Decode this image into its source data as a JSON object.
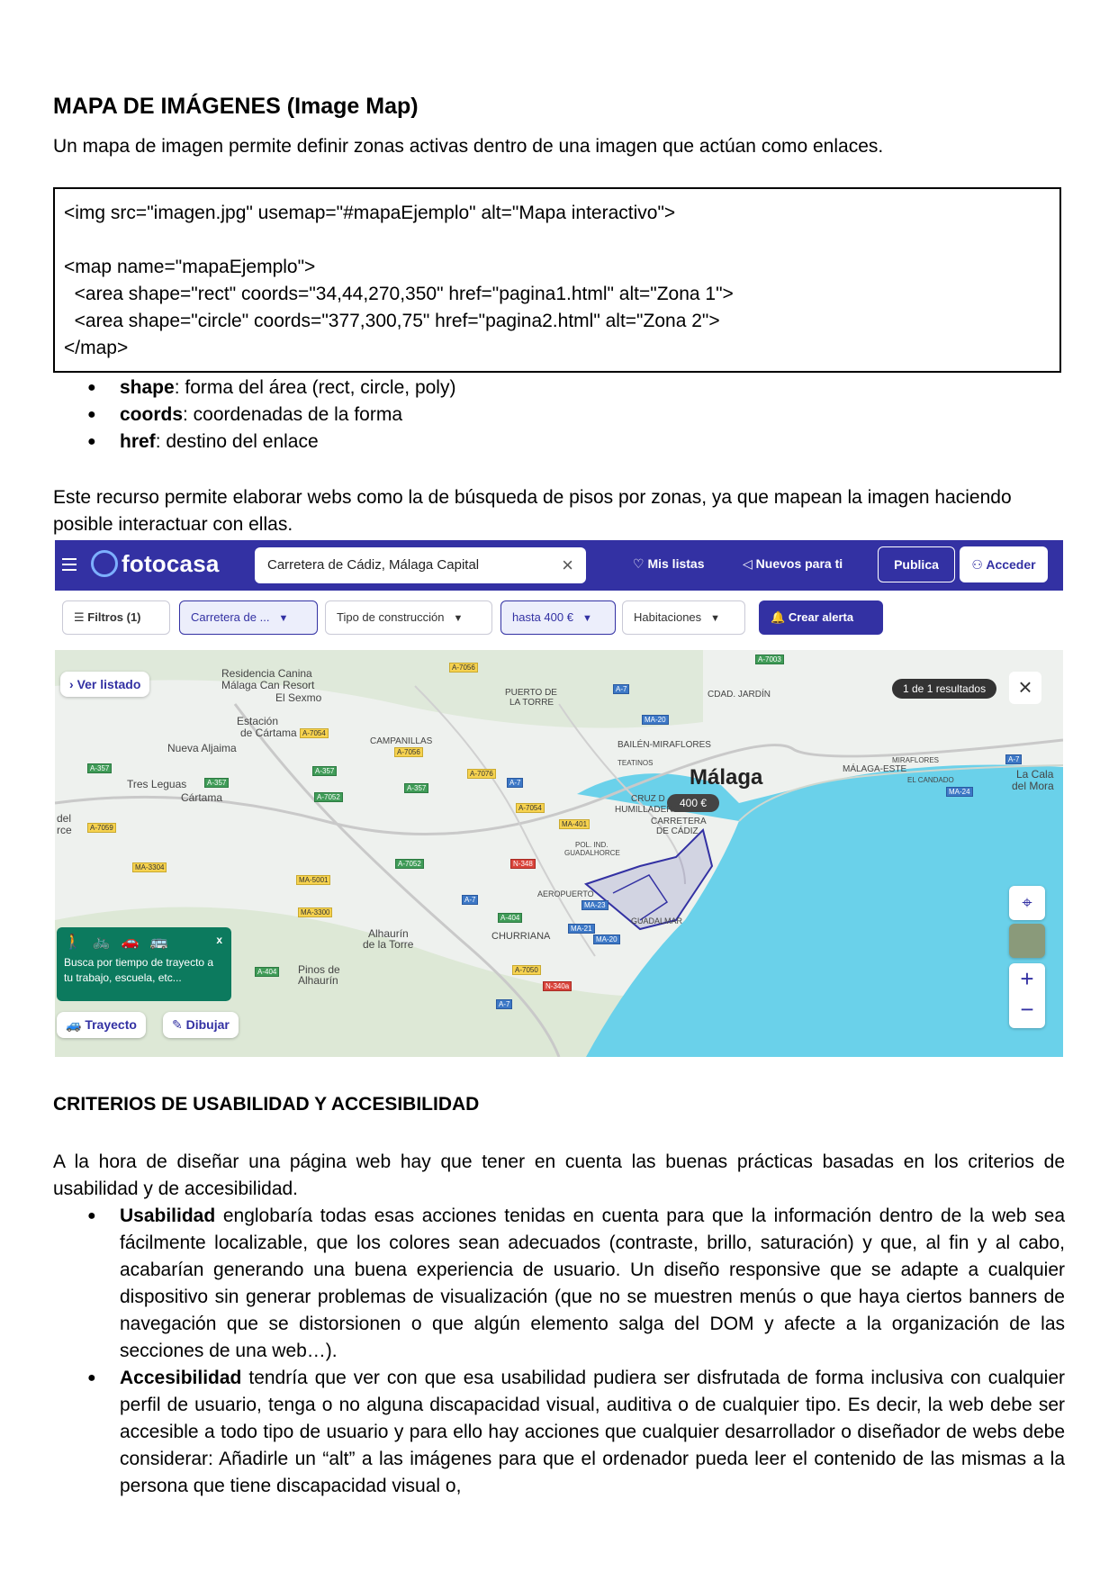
{
  "section1": {
    "title": "MAPA DE IMÁGENES (Image Map)",
    "intro": "Un mapa de imagen permite definir zonas activas dentro de una imagen que actúan como enlaces.",
    "code_lines": [
      "<img src=\"imagen.jpg\" usemap=\"#mapaEjemplo\" alt=\"Mapa interactivo\">",
      "",
      "<map name=\"mapaEjemplo\">",
      "  <area shape=\"rect\" coords=\"34,44,270,350\" href=\"pagina1.html\" alt=\"Zona 1\">",
      "  <area shape=\"circle\" coords=\"377,300,75\" href=\"pagina2.html\" alt=\"Zona 2\">",
      "</map>"
    ],
    "bullets": [
      {
        "term": "shape",
        "desc": ": forma del área (rect, circle, poly)"
      },
      {
        "term": "coords",
        "desc": ": coordenadas de la forma"
      },
      {
        "term": "href",
        "desc": ": destino del enlace"
      }
    ],
    "paragraph": "Este recurso permite elaborar webs como la de búsqueda de pisos por zonas, ya que mapean la imagen haciendo posible interactuar con ellas."
  },
  "screenshot": {
    "logo": "fotocasa",
    "search_value": "Carretera de Cádiz, Málaga Capital",
    "nav": {
      "mis_listas": "Mis listas",
      "nuevos": "Nuevos para ti",
      "publica": "Publica",
      "acceder": "Acceder"
    },
    "filters": {
      "filtros": "Filtros (1)",
      "zona": "Carretera de ...",
      "tipo": "Tipo de construcción",
      "precio": "hasta 400 €",
      "habitaciones": "Habitaciones",
      "alerta": "Crear alerta"
    },
    "map": {
      "ver_listado": "Ver listado",
      "results": "1 de 1 resultados",
      "price_pin": "400 €",
      "city": "Málaga",
      "trayecto": "Trayecto",
      "dibujar": "Dibujar",
      "tip_text": "Busca por tiempo de trayecto a tu trabajo, escuela, etc...",
      "places": [
        {
          "id": "residencia",
          "text": "Residencia Canina"
        },
        {
          "id": "can-resort",
          "text": "Málaga Can Resort"
        },
        {
          "id": "el-sexmo",
          "text": "El Sexmo"
        },
        {
          "id": "estacion",
          "text": "Estación"
        },
        {
          "id": "cartama-est",
          "text": "de Cártama"
        },
        {
          "id": "nueva-aljaima",
          "text": "Nueva Aljaima"
        },
        {
          "id": "tres-leguas",
          "text": "Tres Leguas"
        },
        {
          "id": "cartama",
          "text": "Cártama"
        },
        {
          "id": "campanillas",
          "text": "CAMPANILLAS"
        },
        {
          "id": "puerto-torre",
          "text": "PUERTO DE"
        },
        {
          "id": "la-torre",
          "text": "LA TORRE"
        },
        {
          "id": "cdad-jardin",
          "text": "CDAD. JARDÍN"
        },
        {
          "id": "bailen",
          "text": "BAILÉN-MIRAFLORES"
        },
        {
          "id": "teatinos",
          "text": "TEATINOS"
        },
        {
          "id": "malaga-este",
          "text": "MÁLAGA-ESTE"
        },
        {
          "id": "miraflores",
          "text": "MIRAFLORES"
        },
        {
          "id": "el-candado",
          "text": "EL CANDADO"
        },
        {
          "id": "la-cala",
          "text": "La Cala"
        },
        {
          "id": "del-mora",
          "text": "del Mora"
        },
        {
          "id": "cruz",
          "text": "CRUZ D"
        },
        {
          "id": "humilladero",
          "text": "HUMILLADERO"
        },
        {
          "id": "carretera",
          "text": "CARRETERA"
        },
        {
          "id": "de-cadiz",
          "text": "DE CÁDIZ"
        },
        {
          "id": "pol-ind",
          "text": "POL. IND."
        },
        {
          "id": "guadalhorce",
          "text": "GUADALHORCE"
        },
        {
          "id": "aeropuerto",
          "text": "AEROPUERTO"
        },
        {
          "id": "guadalmar",
          "text": "GUADALMAR"
        },
        {
          "id": "churriana",
          "text": "CHURRIANA"
        },
        {
          "id": "alhaurin",
          "text": "Alhaurín"
        },
        {
          "id": "de-la-torre",
          "text": "de la Torre"
        },
        {
          "id": "pinos",
          "text": "Pinos de"
        },
        {
          "id": "alhaurin2",
          "text": "Alhaurín"
        },
        {
          "id": "del",
          "text": "del"
        },
        {
          "id": "rce",
          "text": "rce"
        }
      ],
      "roads": [
        {
          "id": "a7056a",
          "text": "A-7056"
        },
        {
          "id": "a7003",
          "text": "A-7003"
        },
        {
          "id": "a7",
          "text": "A-7"
        },
        {
          "id": "ma20",
          "text": "MA-20"
        },
        {
          "id": "a7054",
          "text": "A-7054"
        },
        {
          "id": "a7056b",
          "text": "A-7056"
        },
        {
          "id": "a357a",
          "text": "A-357"
        },
        {
          "id": "a357b",
          "text": "A-357"
        },
        {
          "id": "a357c",
          "text": "A-357"
        },
        {
          "id": "a357d",
          "text": "A-357"
        },
        {
          "id": "a7076",
          "text": "A-7076"
        },
        {
          "id": "a7b",
          "text": "A-7"
        },
        {
          "id": "a7052a",
          "text": "A-7052"
        },
        {
          "id": "a7054b",
          "text": "A-7054"
        },
        {
          "id": "ma401",
          "text": "MA-401"
        },
        {
          "id": "a7059",
          "text": "A-7059"
        },
        {
          "id": "a7052b",
          "text": "A-7052"
        },
        {
          "id": "n348",
          "text": "N-348"
        },
        {
          "id": "ma3304",
          "text": "MA-3304"
        },
        {
          "id": "ma5001",
          "text": "MA-5001"
        },
        {
          "id": "ma3300",
          "text": "MA-3300"
        },
        {
          "id": "a7c",
          "text": "A-7"
        },
        {
          "id": "a404a",
          "text": "A-404"
        },
        {
          "id": "ma23",
          "text": "MA-23"
        },
        {
          "id": "ma21",
          "text": "MA-21"
        },
        {
          "id": "ma20b",
          "text": "MA-20"
        },
        {
          "id": "a404b",
          "text": "A-404"
        },
        {
          "id": "a7050",
          "text": "A-7050"
        },
        {
          "id": "n340a",
          "text": "N-340a"
        },
        {
          "id": "a7d",
          "text": "A-7"
        },
        {
          "id": "a7e",
          "text": "A-7"
        },
        {
          "id": "ma24",
          "text": "MA-24"
        }
      ]
    }
  },
  "section2": {
    "title": "CRITERIOS DE USABILIDAD Y ACCESIBILIDAD",
    "intro": "A la hora de diseñar una página web hay que tener en cuenta las buenas prácticas basadas en los criterios de usabilidad y de accesibilidad.",
    "bullets": [
      {
        "term": "Usabilidad",
        "desc": " englobaría todas esas acciones tenidas en cuenta para que la información dentro de la web sea fácilmente localizable, que los colores sean adecuados (contraste, brillo, saturación) y que, al fin y al cabo, acabarían generando una buena experiencia de usuario. Un diseño responsive que se adapte a cualquier dispositivo sin generar problemas de visualización (que no se muestren menús o que haya ciertos banners de navegación que se distorsionen o que algún elemento salga del DOM y afecte a la organización de las secciones de una web…)."
      },
      {
        "term": "Accesibilidad",
        "desc": " tendría que ver con que esa usabilidad pudiera ser disfrutada de forma inclusiva con cualquier perfil de usuario, tenga o no alguna discapacidad visual, auditiva o de cualquier tipo. Es decir, la web debe ser accesible a todo tipo de usuario y para ello hay acciones que cualquier desarrollador o diseñador de webs debe considerar: Añadirle un “alt” a las imágenes para que el ordenador pueda leer el contenido de las mismas a la persona que tiene discapacidad visual o,"
      }
    ]
  }
}
